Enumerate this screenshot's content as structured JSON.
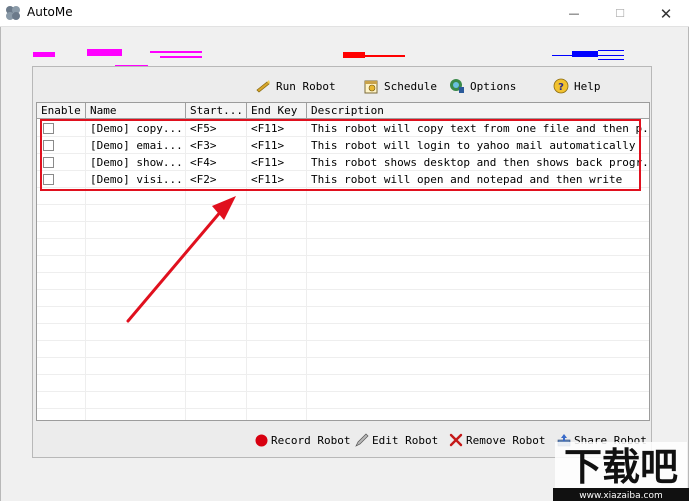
{
  "window": {
    "title": "AutoMe",
    "minimize_glyph": "—",
    "maximize_glyph": "☐",
    "close_glyph": "✕"
  },
  "toolbar": {
    "run_robot": "Run Robot",
    "schedule": "Schedule",
    "options": "Options",
    "help": "Help"
  },
  "table": {
    "columns": [
      "Enable",
      "Name",
      "Start...",
      "End Key",
      "Description"
    ],
    "rows": [
      {
        "enabled": false,
        "name": "[Demo] copy...",
        "start": "<F5>",
        "end_key": "<F11>",
        "description": "This robot will copy text from one file and then p..."
      },
      {
        "enabled": false,
        "name": "[Demo] emai...",
        "start": "<F3>",
        "end_key": "<F11>",
        "description": "This robot will login to yahoo mail automatically"
      },
      {
        "enabled": false,
        "name": "[Demo] show...",
        "start": "<F4>",
        "end_key": "<F11>",
        "description": "This robot shows desktop and then shows back progr..."
      },
      {
        "enabled": false,
        "name": "[Demo] visi...",
        "start": "<F2>",
        "end_key": "<F11>",
        "description": "This robot will open and notepad and then write"
      }
    ]
  },
  "bottom_bar": {
    "record_robot": "Record Robot",
    "edit_robot": "Edit Robot",
    "remove_robot": "Remove Robot",
    "share_robot": "Share Robot"
  },
  "colors": {
    "highlight": "#e0101e",
    "redaction_magenta": "#ff00ff",
    "redaction_red": "#ff0000",
    "redaction_blue": "#0000ff"
  },
  "watermark": {
    "text": "下载吧",
    "url": "www.xiazaiba.com"
  }
}
